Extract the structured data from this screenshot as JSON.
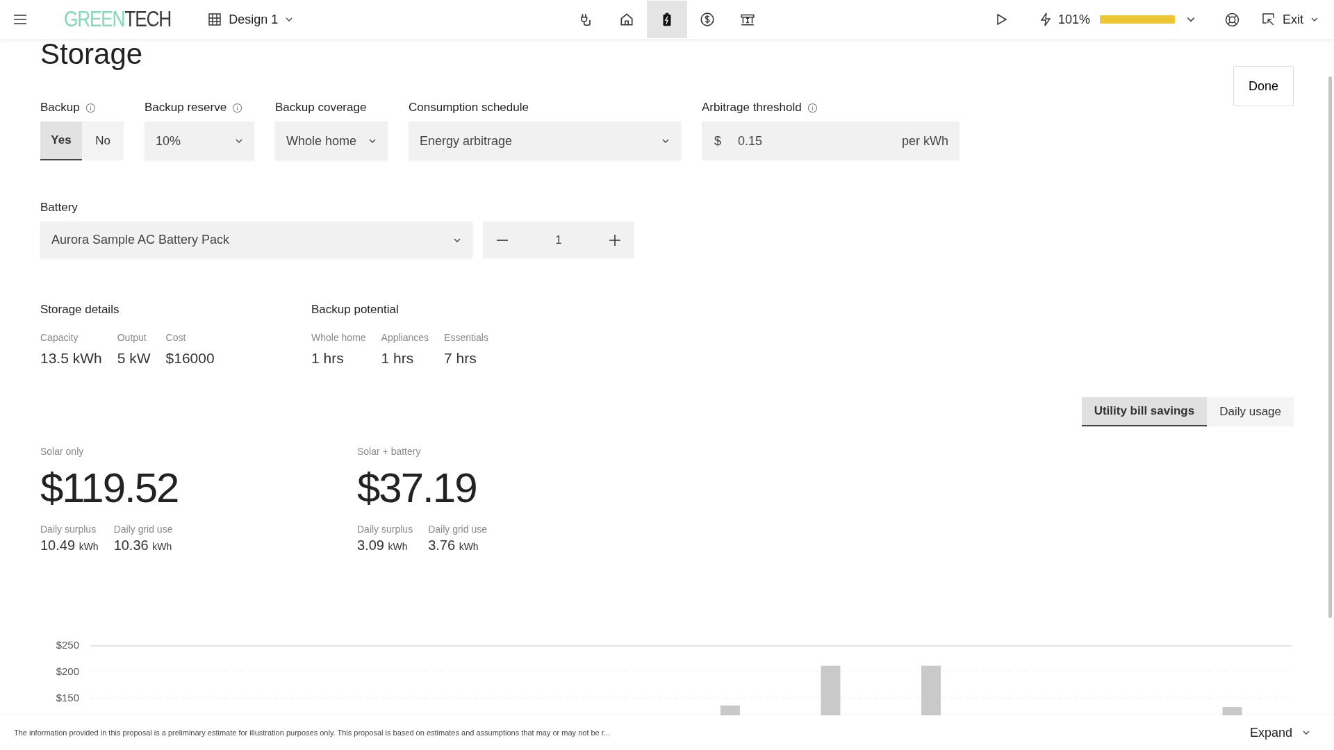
{
  "topbar": {
    "logo": [
      {
        "text": "GREEN",
        "color": "#7fdcb4"
      },
      {
        "text": "TECH",
        "color": "#3a3a3a"
      }
    ],
    "design": "Design 1",
    "nav": [
      {
        "kind": "plug",
        "selected": false
      },
      {
        "kind": "home",
        "selected": false
      },
      {
        "kind": "battery",
        "selected": true
      },
      {
        "kind": "dollar",
        "selected": false
      },
      {
        "kind": "cash",
        "selected": false
      }
    ],
    "production": "101%",
    "production_bar": {
      "level": 1
    },
    "exit": "Exit"
  },
  "page": {
    "title": "Storage",
    "done": "Done"
  },
  "backup": {
    "label": "Backup",
    "info": true,
    "options": [
      {
        "label": "Yes",
        "selected": true
      },
      {
        "label": "No",
        "selected": false
      }
    ]
  },
  "fields": [
    {
      "kind": "select",
      "label": "Backup reserve",
      "info": true,
      "value": "10%"
    },
    {
      "kind": "select",
      "label": "Backup coverage",
      "info": false,
      "value": "Whole home"
    },
    {
      "kind": "select",
      "label": "Consumption schedule",
      "info": false,
      "value": "Energy arbitrage"
    },
    {
      "kind": "currency",
      "label": "Arbitrage threshold",
      "info": true,
      "prefix": "$",
      "value": "0.15",
      "suffix": "per kWh"
    }
  ],
  "battery": {
    "label": "Battery",
    "value": "Aurora Sample AC Battery Pack",
    "quantity": "1"
  },
  "storage_details": {
    "title": "Storage details",
    "items": [
      {
        "label": "Capacity",
        "value": "13.5 kWh"
      },
      {
        "label": "Output",
        "value": "5 kW"
      },
      {
        "label": "Cost",
        "value": "$16000"
      }
    ]
  },
  "backup_potential": {
    "title": "Backup potential",
    "items": [
      {
        "label": "Whole home",
        "value": "1 hrs"
      },
      {
        "label": "Appliances",
        "value": "1 hrs"
      },
      {
        "label": "Essentials",
        "value": "7 hrs"
      }
    ]
  },
  "view_tabs": [
    {
      "label": "Utility bill savings",
      "selected": true
    },
    {
      "label": "Daily usage",
      "selected": false
    }
  ],
  "scenarios": [
    {
      "label": "Solar only",
      "amount": "$119.52",
      "stats": [
        {
          "label": "Daily surplus",
          "value": "10.49",
          "unit": "kWh"
        },
        {
          "label": "Daily grid use",
          "value": "10.36",
          "unit": "kWh"
        }
      ]
    },
    {
      "label": "Solar + battery",
      "amount": "$37.19",
      "stats": [
        {
          "label": "Daily surplus",
          "value": "3.09",
          "unit": "kWh"
        },
        {
          "label": "Daily grid use",
          "value": "3.76",
          "unit": "kWh"
        }
      ]
    }
  ],
  "chart_data": {
    "type": "bar",
    "ylim": [
      103,
      250
    ],
    "yticks": [
      {
        "value": 250,
        "label": "$250"
      },
      {
        "value": 200,
        "label": "$200"
      },
      {
        "value": 150,
        "label": "$150"
      }
    ],
    "series": [
      {
        "color": "#c9c9c9",
        "values": [
          null,
          null,
          null,
          null,
          null,
          null,
          136,
          211,
          211,
          null,
          null,
          133
        ]
      }
    ]
  },
  "footer": {
    "disclaimer": "The information provided in this proposal is a preliminary estimate for illustration purposes only. This proposal is based on estimates and assumptions that may or may not be r...",
    "expand": "Expand"
  }
}
